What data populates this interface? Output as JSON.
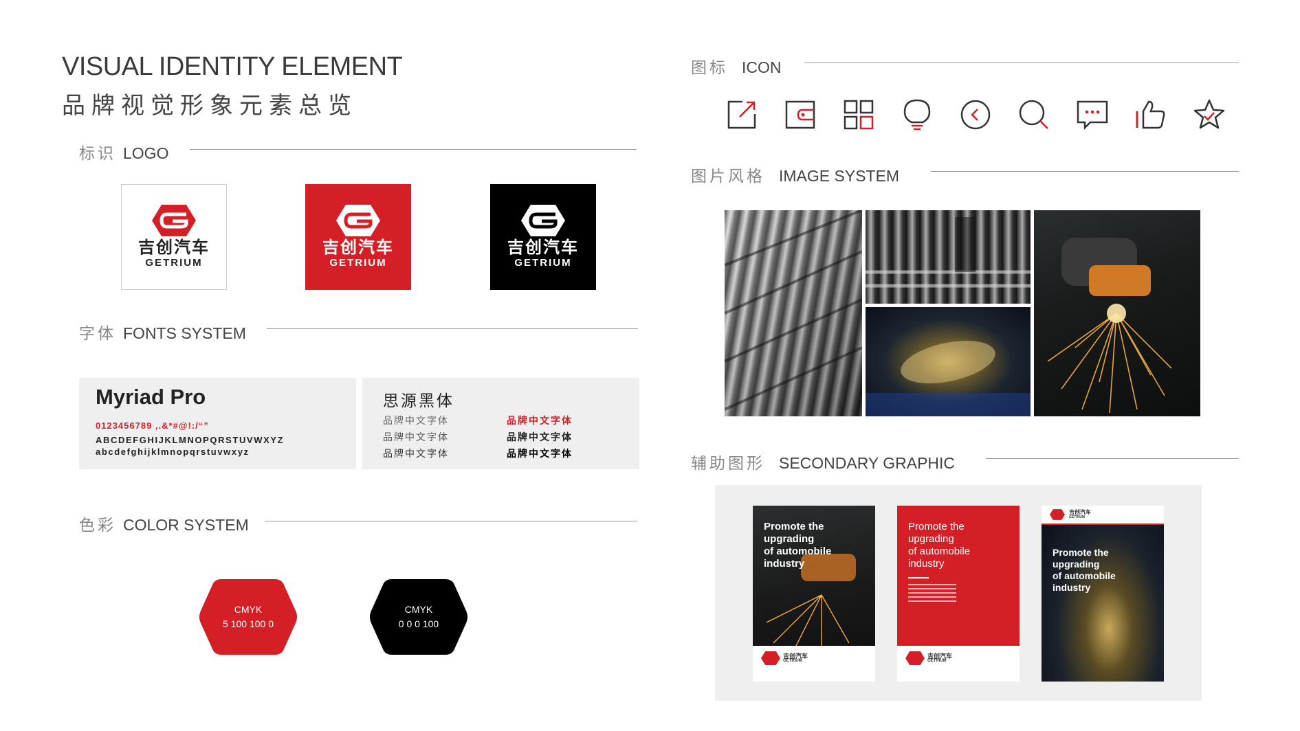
{
  "header": {
    "title_en": "VISUAL IDENTITY ELEMENT",
    "title_zh": "品牌视觉形象元素总览"
  },
  "logo_section": {
    "title_zh": "标识",
    "title_en": "LOGO",
    "logo_text_zh": "吉创汽车",
    "logo_text_en": "GETRIUM",
    "variants": [
      "white",
      "red",
      "black"
    ]
  },
  "fonts_section": {
    "title_zh": "字体",
    "title_en": "FONTS SYSTEM",
    "latin_font": {
      "name": "Myriad Pro",
      "digits": "0123456789 ,.&*#@!:/“”",
      "uppercase": "ABCDEFGHIJKLMNOPQRSTUVWXYZ",
      "lowercase": "abcdefghijklmnopqrstuvwxyz"
    },
    "chinese_font": {
      "name": "思源黑体",
      "sample": "品牌中文字体"
    }
  },
  "color_section": {
    "title_zh": "色彩",
    "title_en": "COLOR SYSTEM",
    "swatches": [
      {
        "label": "CMYK",
        "value": "5 100 100 0",
        "color": "#d51f26"
      },
      {
        "label": "CMYK",
        "value": "0 0 0 100",
        "color": "#000000"
      }
    ]
  },
  "icon_section": {
    "title_zh": "图标",
    "title_en": "ICON",
    "icons": [
      "share-icon",
      "wallet-icon",
      "grid-icon",
      "lightbulb-icon",
      "back-icon",
      "search-icon",
      "message-icon",
      "thumbs-up-icon",
      "star-icon"
    ]
  },
  "image_section": {
    "title_zh": "图片风格",
    "title_en": "IMAGE SYSTEM"
  },
  "secondary_section": {
    "title_zh": "辅助图形",
    "title_en": "SECONDARY GRAPHIC",
    "posters": [
      {
        "variant": "photo-dark",
        "line1": "Promote the",
        "line2": "upgrading",
        "line3": "of automobile",
        "line4": "industry"
      },
      {
        "variant": "red",
        "line1": "Promote the",
        "line2": "upgrading",
        "line3": "of automobile",
        "line4": "industry"
      },
      {
        "variant": "photo-engine",
        "line1": "Promote the",
        "line2": "upgrading",
        "line3": "of automobile",
        "line4": "industry"
      }
    ]
  },
  "colors": {
    "brand_red": "#d51f26",
    "brand_black": "#000000"
  }
}
